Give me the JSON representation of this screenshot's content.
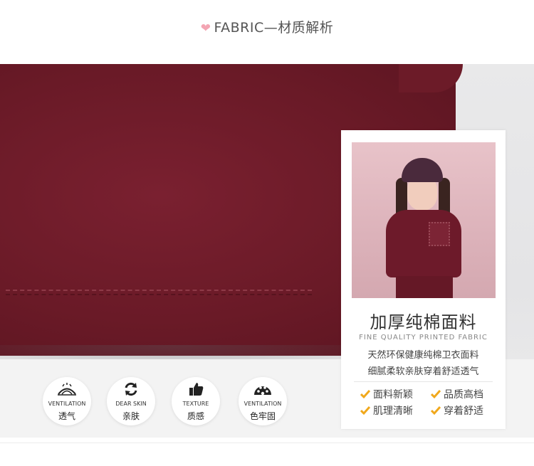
{
  "header": {
    "heart_icon": "heart-icon",
    "title": "FABRIC—材质解析"
  },
  "card": {
    "title": "加厚纯棉面料",
    "subtitle": "FINE QUALITY PRINTED FABRIC",
    "desc_line1": "天然环保健康纯棉卫衣面料",
    "desc_line2": "细腻柔软亲肤穿着舒适透气",
    "features": [
      "面料新颖",
      "品质高档",
      "肌理清晰",
      "穿着舒适"
    ]
  },
  "badges": [
    {
      "icon": "ventilation-icon",
      "en": "VENTILATION",
      "cn": "透气"
    },
    {
      "icon": "refresh-icon",
      "en": "DEAR SKIN",
      "cn": "亲肤"
    },
    {
      "icon": "thumbs-up-icon",
      "en": "TEXTURE",
      "cn": "质感"
    },
    {
      "icon": "palette-icon",
      "en": "VENTILATION",
      "cn": "色牢固"
    }
  ],
  "colors": {
    "fabric": "#6a1a27",
    "check": "#f0a81c",
    "heart": "#f3a5b3"
  }
}
